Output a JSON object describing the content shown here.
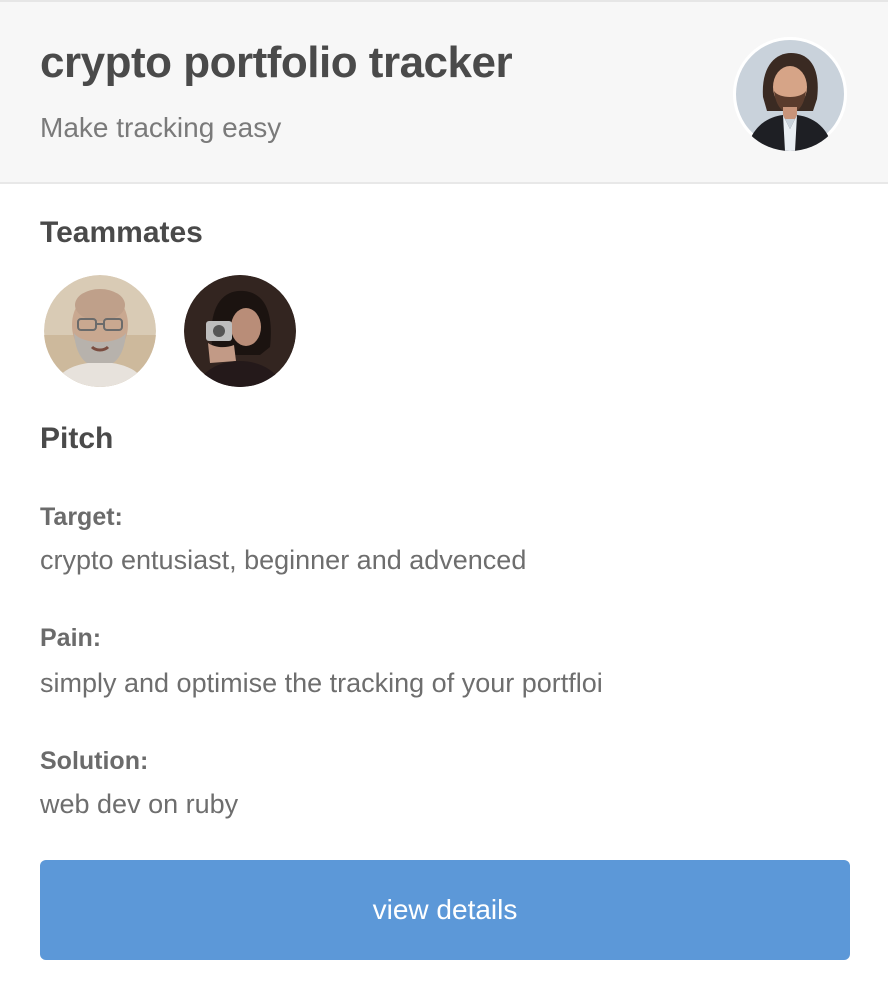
{
  "project": {
    "title": "crypto portfolio tracker",
    "tagline": "Make tracking easy"
  },
  "teammates": {
    "heading": "Teammates"
  },
  "pitch": {
    "heading": "Pitch",
    "target_label": "Target:",
    "target_value": "crypto entusiast, beginner and advenced",
    "pain_label": "Pain:",
    "pain_value": "simply and optimise the tracking of your portfloi",
    "solution_label": "Solution:",
    "solution_value": "web dev on ruby"
  },
  "actions": {
    "view_details_label": "view details"
  },
  "colors": {
    "button_bg": "#5c98d8",
    "header_bg": "#f7f7f7",
    "title_text": "#4a4a4a",
    "muted_text": "#7a7a7a"
  }
}
